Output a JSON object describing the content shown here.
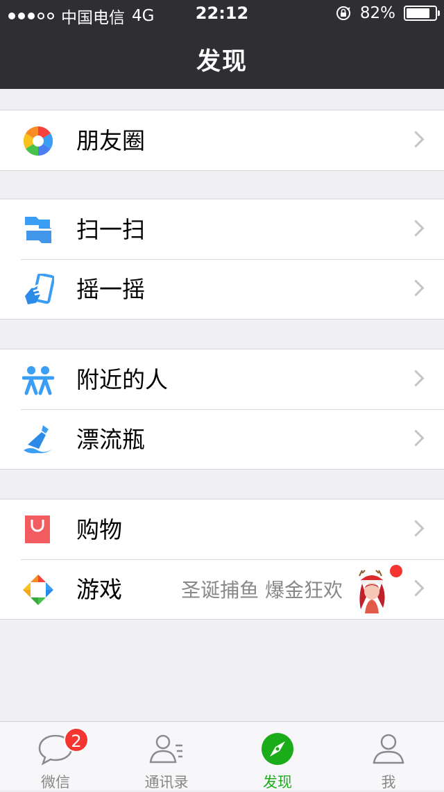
{
  "status_bar": {
    "carrier": "中国电信",
    "network": "4G",
    "time": "22:12",
    "battery_percent": "82%",
    "battery_level": 0.82
  },
  "nav": {
    "title": "发现"
  },
  "groups": [
    {
      "items": [
        {
          "label": "朋友圈",
          "icon": "moments-icon"
        }
      ]
    },
    {
      "items": [
        {
          "label": "扫一扫",
          "icon": "scan-icon"
        },
        {
          "label": "摇一摇",
          "icon": "shake-icon"
        }
      ]
    },
    {
      "items": [
        {
          "label": "附近的人",
          "icon": "people-nearby-icon"
        },
        {
          "label": "漂流瓶",
          "icon": "drift-bottle-icon"
        }
      ]
    },
    {
      "items": [
        {
          "label": "购物",
          "icon": "shopping-icon"
        },
        {
          "label": "游戏",
          "icon": "games-icon",
          "extra": "圣诞捕鱼 爆金狂欢"
        }
      ]
    }
  ],
  "tabbar": {
    "tabs": [
      {
        "label": "微信",
        "icon": "chat-bubble-icon",
        "badge": "2"
      },
      {
        "label": "通讯录",
        "icon": "contacts-icon"
      },
      {
        "label": "发现",
        "icon": "compass-icon",
        "active": true
      },
      {
        "label": "我",
        "icon": "person-icon"
      }
    ]
  },
  "colors": {
    "header_bg": "#2e2e33",
    "accent_green": "#1aad19",
    "badge_red": "#f43530",
    "blue_icon": "#3a9ef5",
    "shopping_red": "#f25b5f"
  }
}
